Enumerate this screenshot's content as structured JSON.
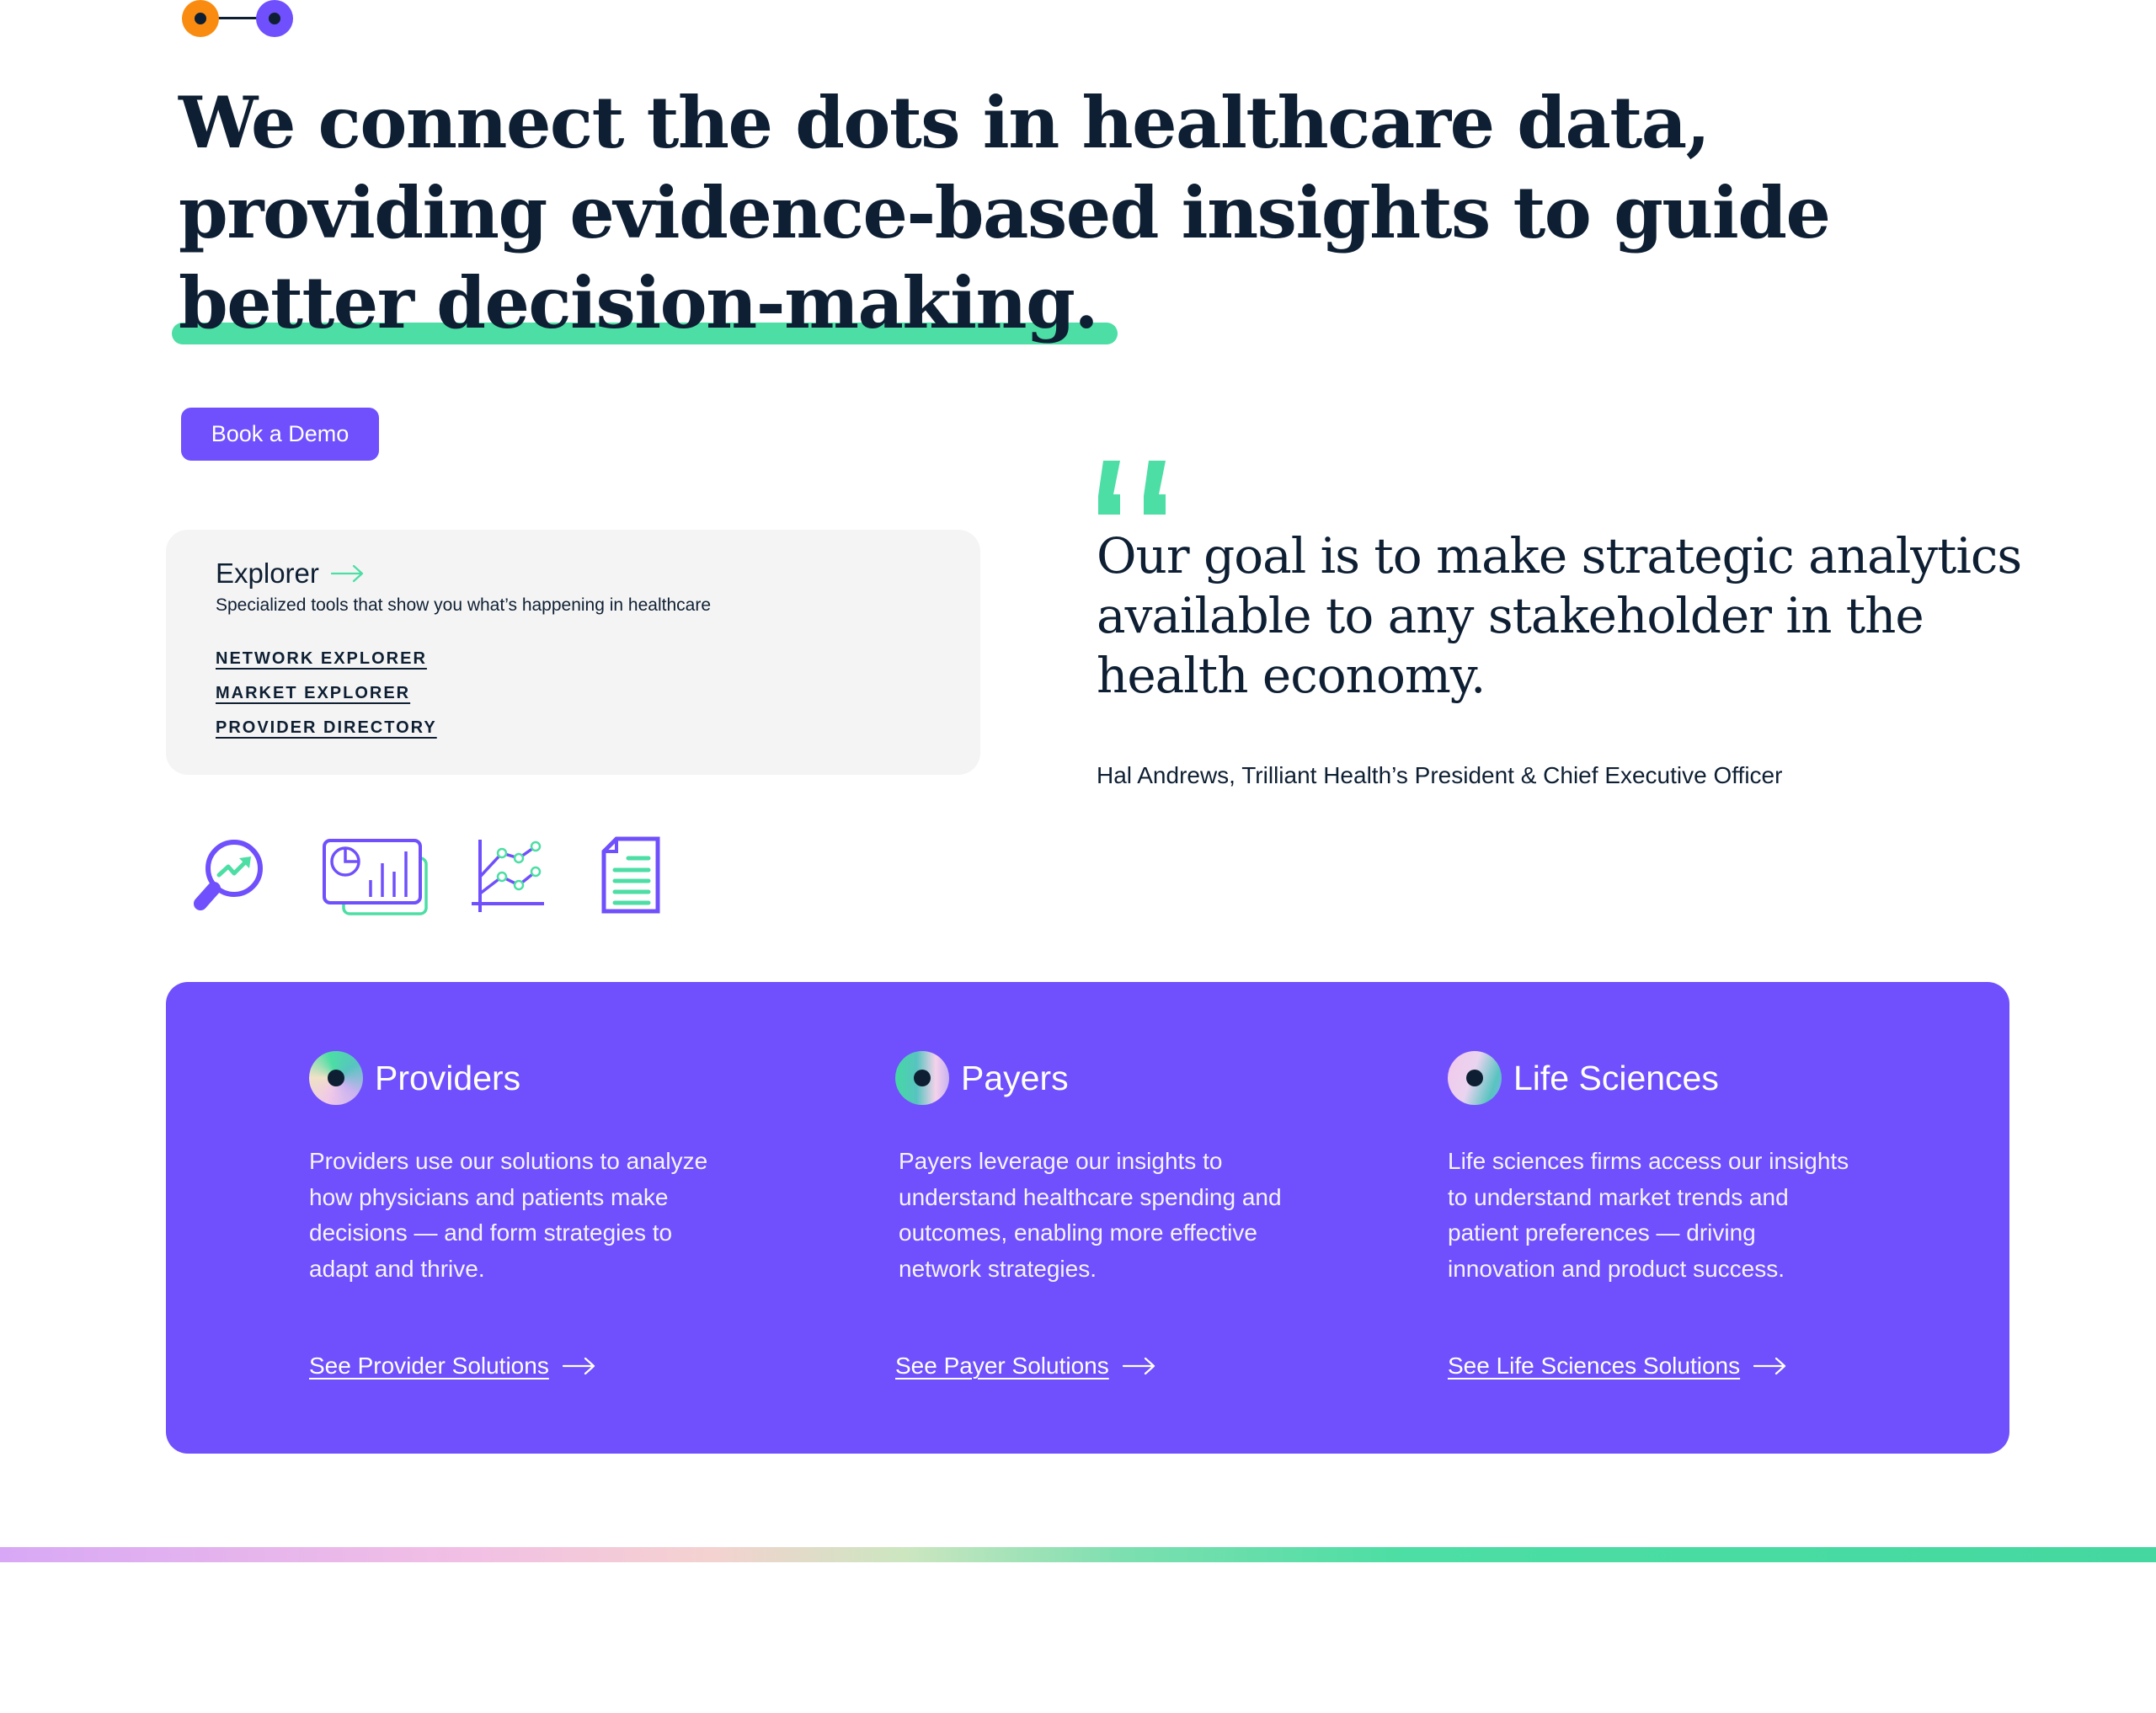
{
  "brand": {
    "colors": {
      "primary_purple": "#7050fc",
      "accent_green": "#4cdea4",
      "accent_orange": "#f98c10",
      "ink": "#0e1f33",
      "card_gray": "#f4f4f4"
    },
    "connector_icon": "connected-dots-icon"
  },
  "hero": {
    "headline_lines": [
      "We connect the dots in healthcare data,",
      "providing evidence-based insights to guide",
      "better decision-making."
    ],
    "cta_label": "Book a Demo"
  },
  "explorer": {
    "title": "Explorer",
    "title_icon": "arrow-right-icon",
    "description": "Specialized tools that show you what’s happening in healthcare",
    "links": [
      {
        "label": "NETWORK EXPLORER"
      },
      {
        "label": "MARKET EXPLORER"
      },
      {
        "label": "PROVIDER DIRECTORY"
      }
    ]
  },
  "feature_icons": [
    {
      "name": "magnifier-trend-icon"
    },
    {
      "name": "dashboard-charts-icon"
    },
    {
      "name": "line-chart-icon"
    },
    {
      "name": "document-icon"
    }
  ],
  "quote": {
    "mark_icon": "quote-mark-icon",
    "text": "Our goal is to make strategic analytics available to any stakeholder in the health economy.",
    "author": "Hal Andrews, Trilliant Health’s President & Chief Executive Officer"
  },
  "solutions": [
    {
      "title": "Providers",
      "icon": "providers-orb-icon",
      "body": "Providers use our solutions to analyze how physicians and patients make decisions — and form strategies to adapt and thrive.",
      "cta": "See Provider Solutions"
    },
    {
      "title": "Payers",
      "icon": "payers-orb-icon",
      "body": "Payers leverage our insights to understand healthcare spending and outcomes, enabling more effective network strategies.",
      "cta": "See Payer Solutions"
    },
    {
      "title": "Life Sciences",
      "icon": "life-sciences-orb-icon",
      "body": "Life sciences firms access our insights to understand market trends and patient preferences — driving innovation and product success.",
      "cta": "See Life Sciences Solutions"
    }
  ]
}
